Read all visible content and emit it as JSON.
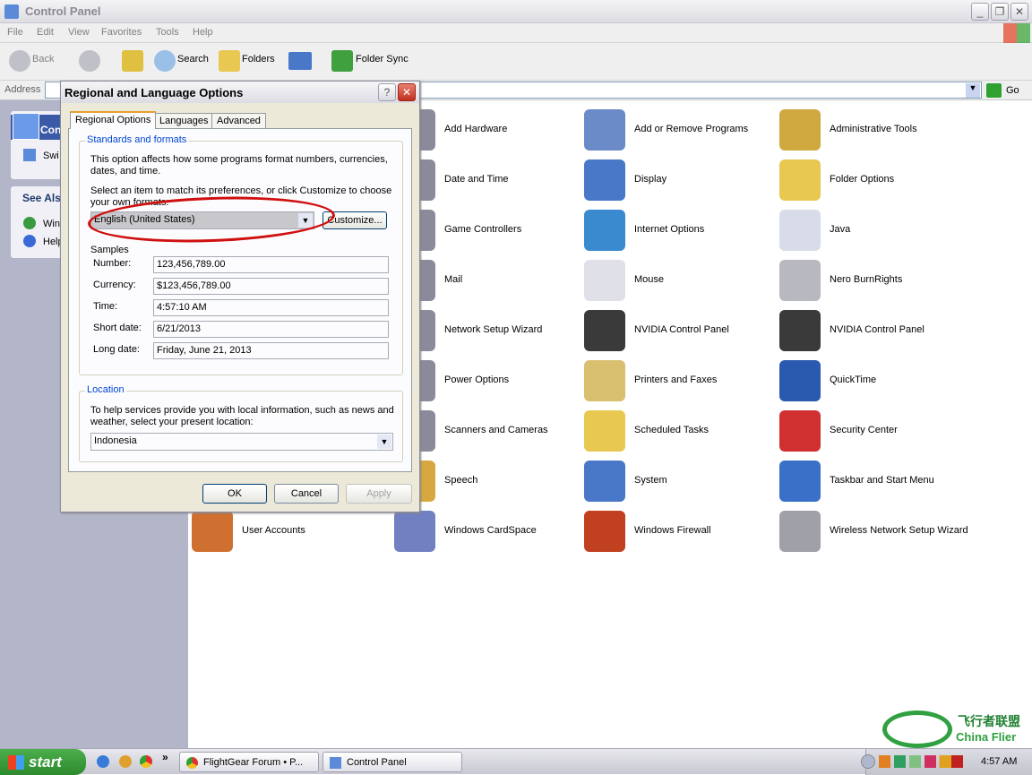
{
  "window": {
    "title": "Control Panel"
  },
  "menu": [
    "File",
    "Edit",
    "View",
    "Favorites",
    "Tools",
    "Help"
  ],
  "toolbar": {
    "back": "Back",
    "search": "Search",
    "folders": "Folders",
    "folder_sync": "Folder Sync"
  },
  "address": {
    "label": "Address",
    "go": "Go"
  },
  "left_pane": {
    "control_panel": "Con",
    "switch": "Swi",
    "see_also": "See Als",
    "win": "Win",
    "help": "Help"
  },
  "items": [
    {
      "label": "Add Hardware",
      "icon": "hardware-icon",
      "color": "#8a8a9a"
    },
    {
      "label": "Add or Remove Programs",
      "icon": "cd-box-icon",
      "color": "#6a8ac8"
    },
    {
      "label": "Administrative Tools",
      "icon": "admin-tools-icon",
      "color": "#d0a840"
    },
    {
      "label": "Date and Time",
      "icon": "clock-icon",
      "color": "#8a8a9a"
    },
    {
      "label": "Display",
      "icon": "display-icon",
      "color": "#4a78c8"
    },
    {
      "label": "Folder Options",
      "icon": "folder-icon",
      "color": "#e8c850"
    },
    {
      "label": "Game Controllers",
      "icon": "joystick-icon",
      "color": "#8a8a9a"
    },
    {
      "label": "Internet Options",
      "icon": "globe-icon",
      "color": "#3a8ad0"
    },
    {
      "label": "Java",
      "icon": "java-icon",
      "color": "#d8dce8"
    },
    {
      "label": "Mail",
      "icon": "mail-icon",
      "color": "#8a8a9a"
    },
    {
      "label": "Mouse",
      "icon": "mouse-icon",
      "color": "#e0e0e8"
    },
    {
      "label": "Nero BurnRights",
      "icon": "disc-lock-icon",
      "color": "#b8b8c0"
    },
    {
      "label": "Network Setup Wizard",
      "icon": "network-icon",
      "color": "#8a8a9a"
    },
    {
      "label": "NVIDIA Control Panel",
      "icon": "nvidia-icon",
      "color": "#3a3a3a"
    },
    {
      "label": "NVIDIA Control Panel",
      "icon": "nvidia-icon",
      "color": "#3a3a3a"
    },
    {
      "label": "Power Options",
      "icon": "power-icon",
      "color": "#8a8a9a"
    },
    {
      "label": "Printers and Faxes",
      "icon": "printer-icon",
      "color": "#d8c070"
    },
    {
      "label": "QuickTime",
      "icon": "quicktime-icon",
      "color": "#2a5ab0"
    },
    {
      "label": "Scanners and Cameras",
      "icon": "scanner-icon",
      "color": "#8a8a9a"
    },
    {
      "label": "Scheduled Tasks",
      "icon": "scheduled-folder-icon",
      "color": "#e8c850"
    },
    {
      "label": "Security Center",
      "icon": "shield-icon",
      "color": "#d03030"
    },
    {
      "label": "Speech",
      "icon": "speech-icon",
      "color": "#d8a840"
    },
    {
      "label": "System",
      "icon": "system-icon",
      "color": "#4a78c8"
    },
    {
      "label": "Taskbar and Start Menu",
      "icon": "taskbar-icon",
      "color": "#3a70c8"
    },
    {
      "label": "User Accounts",
      "icon": "users-icon",
      "color": "#d07030"
    },
    {
      "label": "Windows CardSpace",
      "icon": "cardspace-icon",
      "color": "#7080c0"
    },
    {
      "label": "Windows Firewall",
      "icon": "firewall-icon",
      "color": "#c04020"
    },
    {
      "label": "Wireless Network Setup Wizard",
      "icon": "wireless-icon",
      "color": "#a0a0a8"
    }
  ],
  "dialog": {
    "title": "Regional and Language Options",
    "tabs": [
      "Regional Options",
      "Languages",
      "Advanced"
    ],
    "standards_title": "Standards and formats",
    "standards_desc": "This option affects how some programs format numbers, currencies, dates, and time.",
    "select_desc": "Select an item to match its preferences, or click Customize to choose your own formats:",
    "format_value": "English (United States)",
    "customize": "Customize...",
    "samples_label": "Samples",
    "samples": [
      {
        "label": "Number:",
        "value": "123,456,789.00"
      },
      {
        "label": "Currency:",
        "value": "$123,456,789.00"
      },
      {
        "label": "Time:",
        "value": "4:57:10 AM"
      },
      {
        "label": "Short date:",
        "value": "6/21/2013"
      },
      {
        "label": "Long date:",
        "value": "Friday, June 21, 2013"
      }
    ],
    "location_title": "Location",
    "location_desc": "To help services provide you with local information, such as news and weather, select your present location:",
    "location_value": "Indonesia",
    "ok": "OK",
    "cancel": "Cancel",
    "apply": "Apply",
    "highlight_color": "#d01010"
  },
  "taskbar": {
    "start": "start",
    "tasks": [
      "FlightGear Forum • P...",
      "Control Panel"
    ],
    "clock": "4:57 AM"
  },
  "watermark": {
    "cn": "飞行者联盟",
    "en": "China Flier"
  }
}
